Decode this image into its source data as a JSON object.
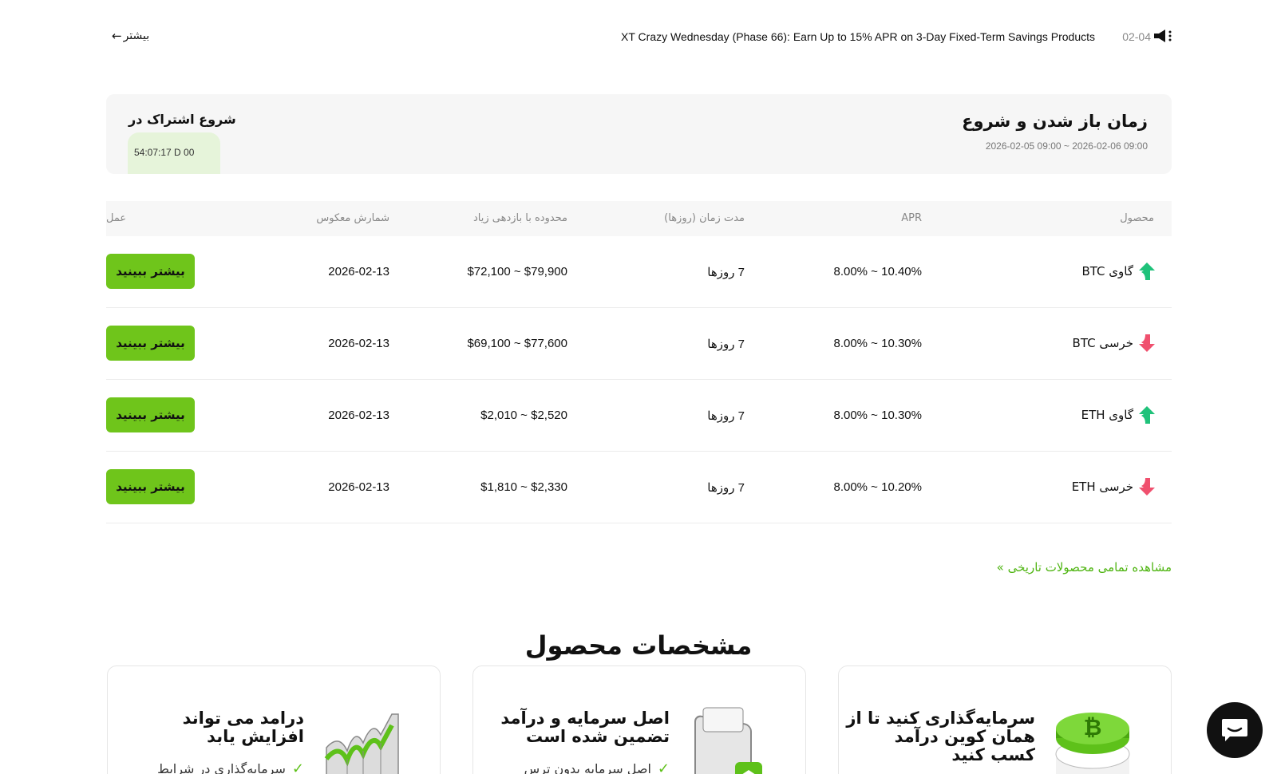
{
  "announcement": {
    "more_label": "بیشتر",
    "title": "XT Crazy Wednesday (Phase 66): Earn Up to 15% APR on 3-Day Fixed-Term Savings Products",
    "date": "02-04"
  },
  "subscription": {
    "title": "زمان باز شدن و شروع",
    "range": "2026-02-05 09:00 ~ 2026-02-06 09:00",
    "start_label": "شروع اشتراک در",
    "countdown": "54:07:17 D 00"
  },
  "table": {
    "headers": {
      "product": "محصول",
      "apr": "APR",
      "duration": "مدت زمان (روزها)",
      "range": "محدوده با بازدهی زیاد",
      "countdown": "شمارش معکوس",
      "action": "عمل"
    },
    "rows": [
      {
        "product": "گاوی BTC",
        "direction": "up",
        "apr": "8.00% ~ 10.40%",
        "duration": "7 روزها",
        "range": "$72,100 ~ $79,900",
        "countdown": "2026-02-13",
        "action": "بیشتر ببینید"
      },
      {
        "product": "خرسی BTC",
        "direction": "down",
        "apr": "8.00% ~ 10.30%",
        "duration": "7 روزها",
        "range": "$69,100 ~ $77,600",
        "countdown": "2026-02-13",
        "action": "بیشتر ببینید"
      },
      {
        "product": "گاوی ETH",
        "direction": "up",
        "apr": "8.00% ~ 10.30%",
        "duration": "7 روزها",
        "range": "$2,010 ~ $2,520",
        "countdown": "2026-02-13",
        "action": "بیشتر ببینید"
      },
      {
        "product": "خرسی ETH",
        "direction": "down",
        "apr": "8.00% ~ 10.20%",
        "duration": "7 روزها",
        "range": "$1,810 ~ $2,330",
        "countdown": "2026-02-13",
        "action": "بیشتر ببینید"
      }
    ]
  },
  "history_link": "مشاهده تمامی محصولات تاریخی »",
  "features": {
    "title": "مشخصات محصول",
    "cards": [
      {
        "title_line1": "سرمایه‌گذاری کنید تا از",
        "title_line2": "همان کوین درآمد",
        "title_line3": "کسب کنید",
        "bullet": ""
      },
      {
        "title_line1": "اصل سرمایه و درآمد",
        "title_line2": "تضمین شده است",
        "title_line3": "",
        "bullet": "اصل سرمایه بدون ترس"
      },
      {
        "title_line1": "درامد می تواند",
        "title_line2": "افزایش یابد",
        "title_line3": "",
        "bullet": "سرمایه‌گذاری در شرایط"
      }
    ]
  },
  "colors": {
    "accent_green": "#6fc51b",
    "up_arrow": "#1fc27a",
    "down_arrow": "#f0506e",
    "link_green": "#4fb512"
  }
}
